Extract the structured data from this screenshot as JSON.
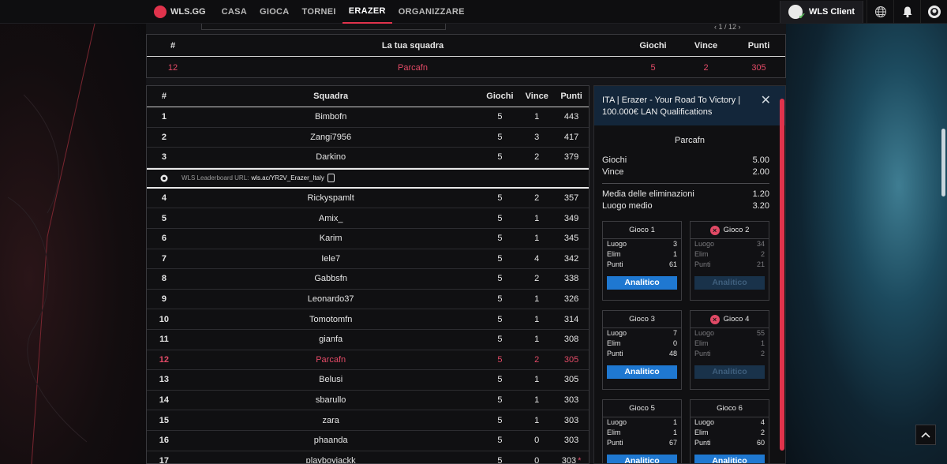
{
  "nav": {
    "brand": "WLS.GG",
    "items": [
      {
        "label": "CASA",
        "active": false
      },
      {
        "label": "GIOCA",
        "active": false
      },
      {
        "label": "TORNEI",
        "active": false
      },
      {
        "label": "ERAZER",
        "active": true
      },
      {
        "label": "ORGANIZZARE",
        "active": false
      }
    ],
    "client_label": "WLS Client",
    "icons": [
      "globe-icon",
      "bell-icon",
      "profile-icon"
    ],
    "accent": "#e0334c"
  },
  "pager": "‹  1  /  12  ›",
  "your_team": {
    "headers": {
      "rank": "#",
      "team": "La tua squadra",
      "games": "Giochi",
      "wins": "Vince",
      "points": "Punti"
    },
    "row": {
      "rank": "12",
      "team": "Parcafn",
      "games": "5",
      "wins": "2",
      "points": "305"
    }
  },
  "leaderboard": {
    "headers": {
      "rank": "#",
      "team": "Squadra",
      "games": "Giochi",
      "wins": "Vince",
      "points": "Punti"
    },
    "url_label": "WLS Leaderboard URL:",
    "url_value": "wls.ac/YR2V_Erazer_Italy",
    "rows": [
      {
        "rank": "1",
        "team": "Bimbofn",
        "games": "5",
        "wins": "1",
        "points": "443"
      },
      {
        "rank": "2",
        "team": "Zangi7956",
        "games": "5",
        "wins": "3",
        "points": "417"
      },
      {
        "rank": "3",
        "team": "Darkino",
        "games": "5",
        "wins": "2",
        "points": "379"
      },
      {
        "rank": "4",
        "team": "Rickyspamlt",
        "games": "5",
        "wins": "2",
        "points": "357"
      },
      {
        "rank": "5",
        "team": "Amix_",
        "games": "5",
        "wins": "1",
        "points": "349"
      },
      {
        "rank": "6",
        "team": "Karim",
        "games": "5",
        "wins": "1",
        "points": "345"
      },
      {
        "rank": "7",
        "team": "Iele7",
        "games": "5",
        "wins": "4",
        "points": "342"
      },
      {
        "rank": "8",
        "team": "Gabbsfn",
        "games": "5",
        "wins": "2",
        "points": "338"
      },
      {
        "rank": "9",
        "team": "Leonardo37",
        "games": "5",
        "wins": "1",
        "points": "326"
      },
      {
        "rank": "10",
        "team": "Tomotomfn",
        "games": "5",
        "wins": "1",
        "points": "314"
      },
      {
        "rank": "11",
        "team": "gianfa",
        "games": "5",
        "wins": "1",
        "points": "308"
      },
      {
        "rank": "12",
        "team": "Parcafn",
        "games": "5",
        "wins": "2",
        "points": "305",
        "highlight": true
      },
      {
        "rank": "13",
        "team": "Belusi",
        "games": "5",
        "wins": "1",
        "points": "305"
      },
      {
        "rank": "14",
        "team": "sbarullo",
        "games": "5",
        "wins": "1",
        "points": "303"
      },
      {
        "rank": "15",
        "team": "zara",
        "games": "5",
        "wins": "1",
        "points": "303"
      },
      {
        "rank": "16",
        "team": "phaanda",
        "games": "5",
        "wins": "0",
        "points": "303"
      },
      {
        "rank": "17",
        "team": "playboyjackk",
        "games": "5",
        "wins": "0",
        "points": "303",
        "star": "*"
      }
    ]
  },
  "panel": {
    "title": "ITA | Erazer - Your Road To Victory | 100.000€ LAN Qualifications",
    "team": "Parcafn",
    "stats1": [
      {
        "label": "Giochi",
        "value": "5.00"
      },
      {
        "label": "Vince",
        "value": "2.00"
      }
    ],
    "stats2": [
      {
        "label": "Media delle eliminazioni",
        "value": "1.20"
      },
      {
        "label": "Luogo medio",
        "value": "3.20"
      }
    ],
    "games": [
      {
        "title": "Gioco 1",
        "dim": false,
        "place": "3",
        "elims": "1",
        "points": "61"
      },
      {
        "title": "Gioco 2",
        "dim": true,
        "place": "34",
        "elims": "2",
        "points": "21"
      },
      {
        "title": "Gioco 3",
        "dim": false,
        "place": "7",
        "elims": "0",
        "points": "48"
      },
      {
        "title": "Gioco 4",
        "dim": true,
        "place": "55",
        "elims": "1",
        "points": "2"
      },
      {
        "title": "Gioco 5",
        "dim": false,
        "place": "1",
        "elims": "1",
        "points": "67"
      },
      {
        "title": "Gioco 6",
        "dim": false,
        "place": "4",
        "elims": "2",
        "points": "60"
      }
    ],
    "game_labels": {
      "place": "Luogo",
      "elims": "Elim",
      "points": "Punti",
      "button": "Analitico"
    }
  }
}
